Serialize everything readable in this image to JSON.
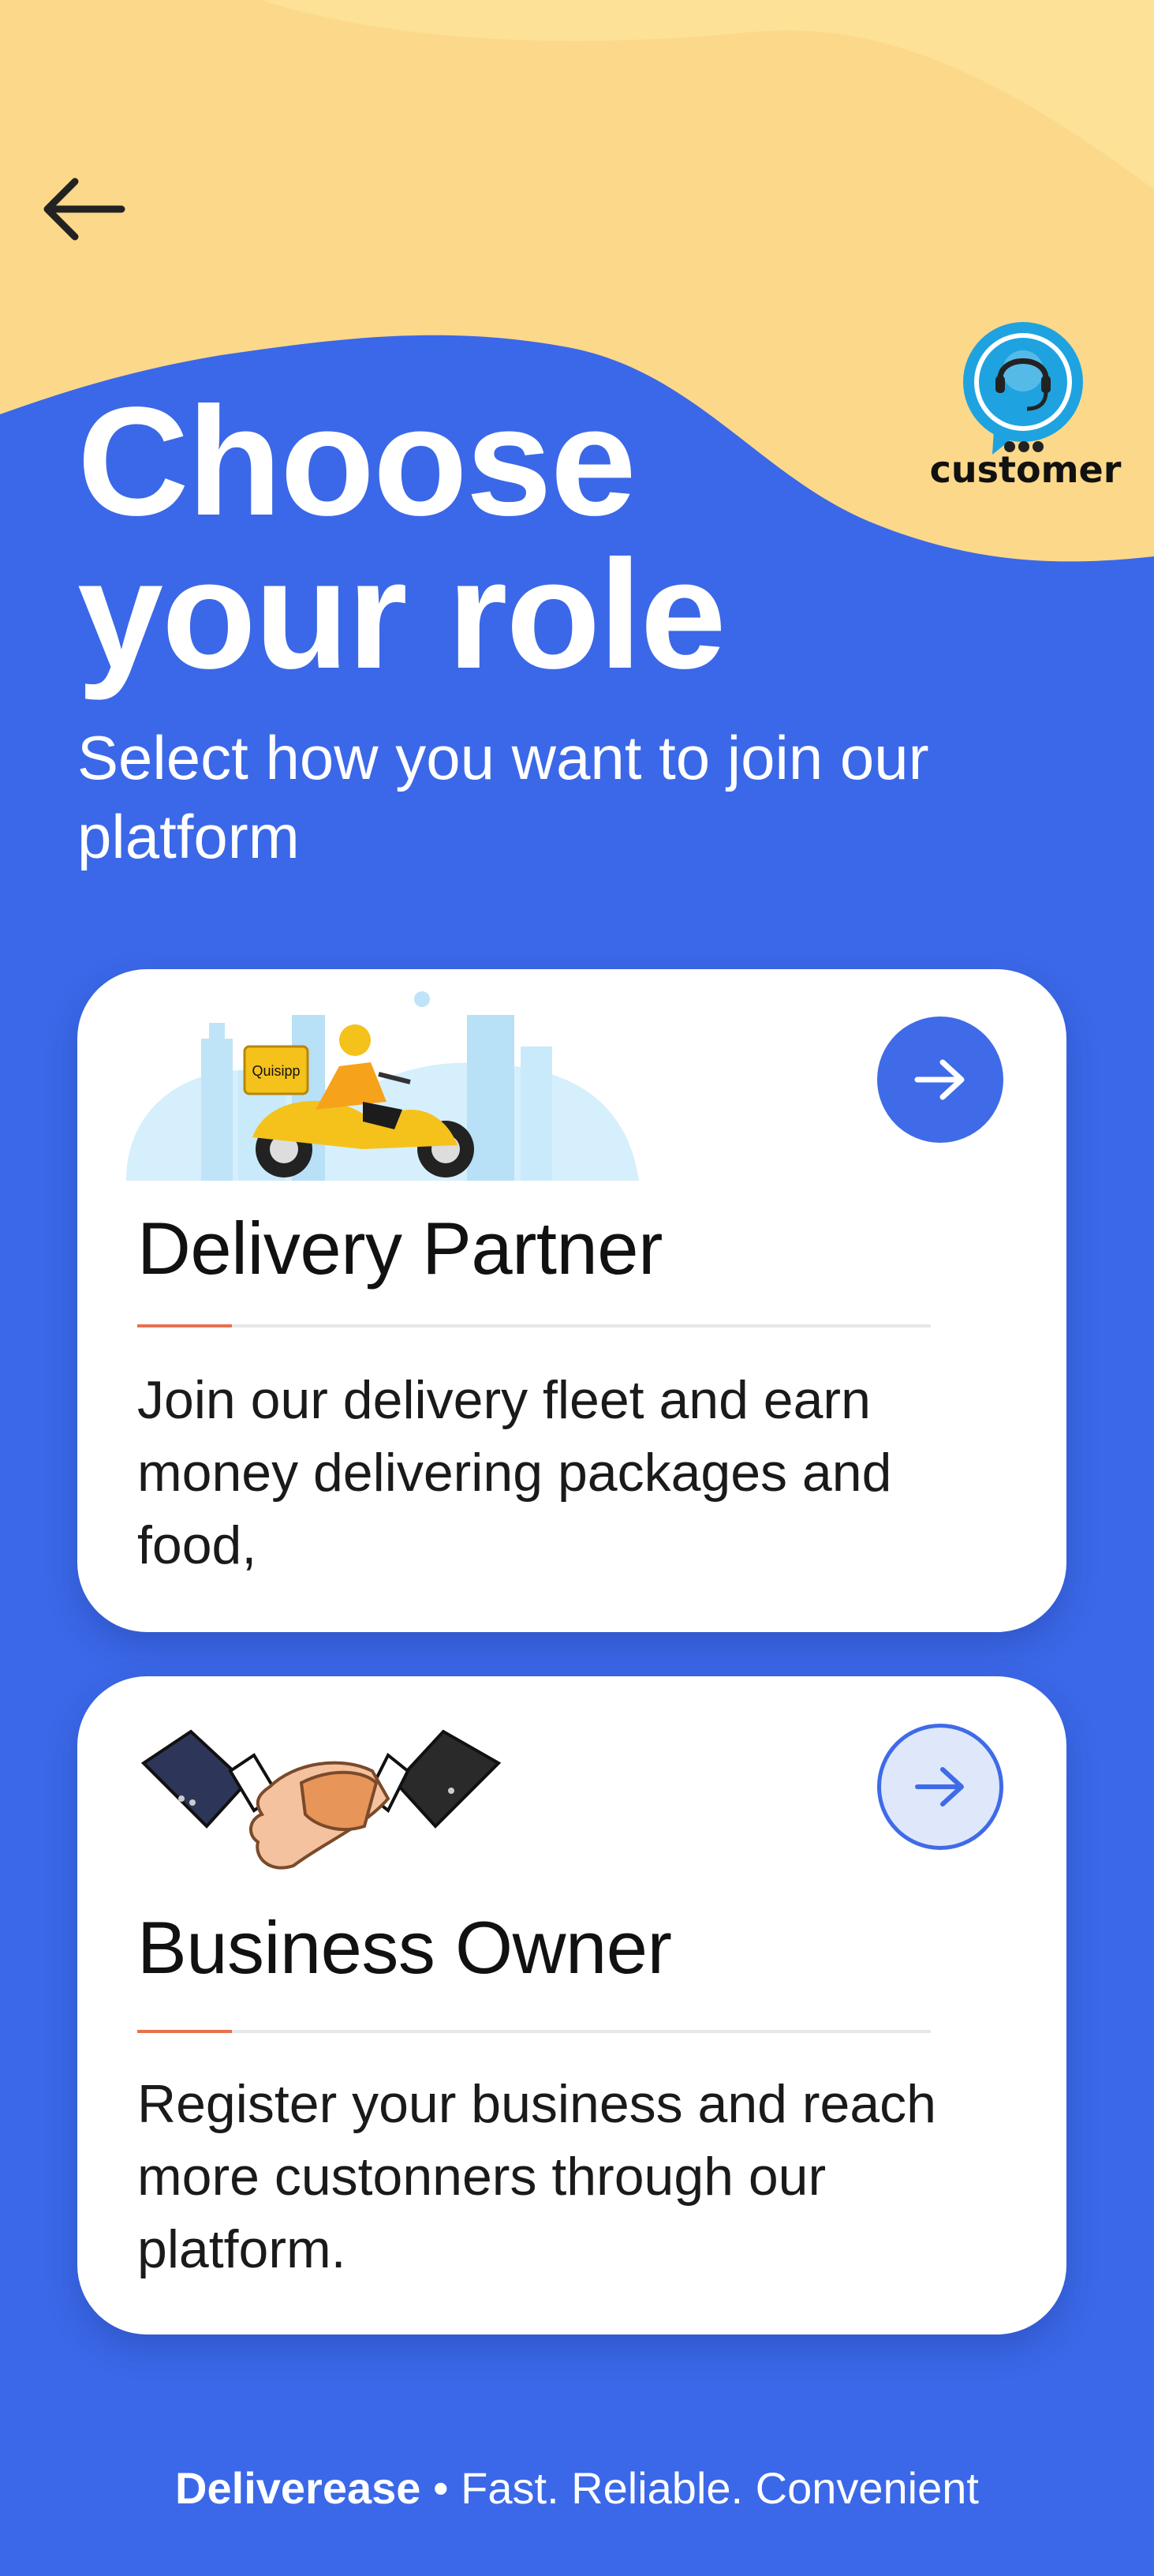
{
  "colors": {
    "primary": "#3b68e8",
    "header": "#fcd88a",
    "accent": "#e8704f",
    "card": "#ffffff"
  },
  "icons": {
    "back": "arrow-left-icon",
    "support": "headset-chat-icon",
    "card_arrow": "arrow-right-icon"
  },
  "header": {
    "support_label": "customer"
  },
  "heading": {
    "line1": "Choose",
    "line2": "your role",
    "subtitle": "Select how you want to join our platform"
  },
  "roles": [
    {
      "title": "Delivery Partner",
      "description": "Join our delivery fleet and earn money delivering packages and food,",
      "illustration": "delivery-scooter-illustration",
      "box_label": "Quisipp"
    },
    {
      "title": "Business Owner",
      "description": "Register your business and reach more custonners through our platform.",
      "illustration": "handshake-illustration"
    }
  ],
  "footer": {
    "brand": "Deliverease",
    "separator": "•",
    "tagline": "Fast. Reliable. Convenient"
  }
}
